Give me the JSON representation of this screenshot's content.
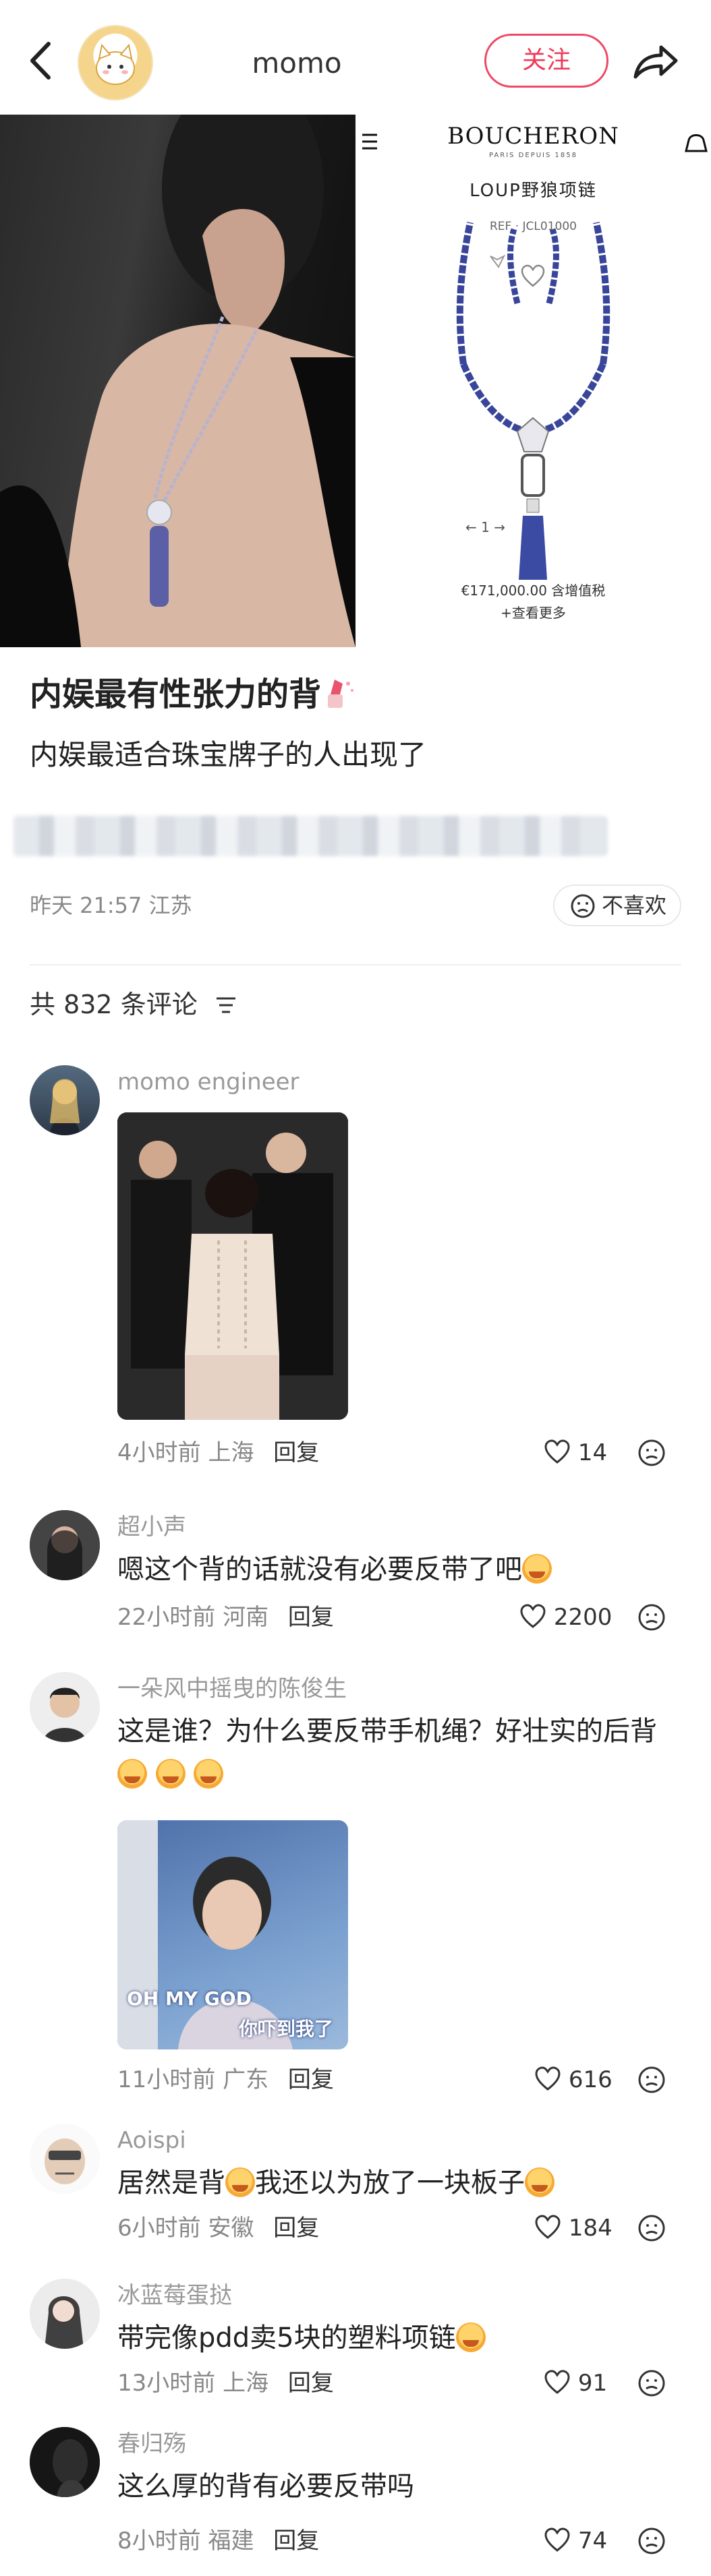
{
  "header": {
    "author_name": "momo",
    "follow_label": "关注"
  },
  "hero": {
    "brand": "BOUCHERON",
    "brand_sub": "PARIS DEPUIS 1858",
    "product_name": "LOUP野狼项链",
    "product_ref": "REF · JCL01000",
    "pager": "←     1     →",
    "price": "€171,000.00 含增值税",
    "more": "+查看更多"
  },
  "post": {
    "title": "内娱最有性张力的背",
    "body": "内娱最适合珠宝牌子的人出现了",
    "meta": "昨天 21:57 江苏",
    "dislike_label": "不喜欢",
    "comment_count": "共 832 条评论"
  },
  "comments": [
    {
      "user": "momo engineer",
      "text": "",
      "time": "4小时前",
      "location": "上海",
      "reply": "回复",
      "likes": "14"
    },
    {
      "user": "超小声",
      "text": "嗯这个背的话就没有必要反带了吧",
      "time": "22小时前",
      "location": "河南",
      "reply": "回复",
      "likes": "2200"
    },
    {
      "user": "一朵风中摇曳的陈俊生",
      "text": "这是谁？为什么要反带手机绳？好壮实的后背",
      "time": "11小时前",
      "location": "广东",
      "reply": "回复",
      "likes": "616",
      "meme_caption_1": "OH MY GOD",
      "meme_caption_2": "你吓到我了"
    },
    {
      "user": "Aoispi",
      "text_1": "居然是背",
      "text_2": "我还以为放了一块板子",
      "time": "6小时前",
      "location": "安徽",
      "reply": "回复",
      "likes": "184"
    },
    {
      "user": "冰蓝莓蛋挞",
      "text": "带完像pdd卖5块的塑料项链",
      "time": "13小时前",
      "location": "上海",
      "reply": "回复",
      "likes": "91"
    },
    {
      "user": "春归殇",
      "text": "这么厚的背有必要反带吗",
      "time": "8小时前",
      "location": "福建",
      "reply": "回复",
      "likes": "74"
    }
  ],
  "colors": {
    "accent": "#ee3a57",
    "muted": "#888888"
  }
}
